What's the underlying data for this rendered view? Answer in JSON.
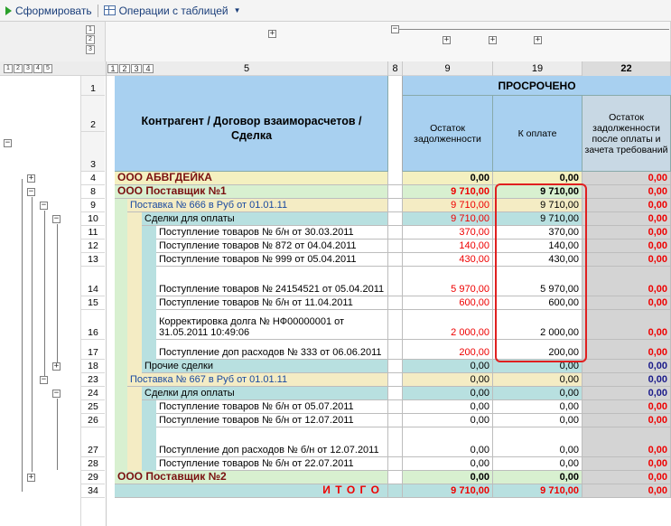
{
  "toolbar": {
    "generate_label": "Сформировать",
    "table_ops_label": "Операции с таблицей"
  },
  "column_numbers": {
    "c5": "5",
    "c8": "8",
    "c9": "9",
    "c19": "19",
    "c22": "22"
  },
  "level_buttons": [
    "1",
    "2",
    "3",
    "4",
    "5"
  ],
  "col_level_buttons": [
    "1",
    "2",
    "3"
  ],
  "header": {
    "overdue": "ПРОСРОЧЕНО",
    "main": "Контрагент / Договор взаиморасчетов / Сделка",
    "col9": "Остаток задолженности",
    "col19": "К оплате",
    "col22": "Остаток задолженности после оплаты и зачета требований"
  },
  "header_rows": [
    "1",
    "2",
    "3"
  ],
  "rows": [
    {
      "n": "4",
      "name": "ООО АБВГДЕЙКА",
      "c9": "0,00",
      "c19": "0,00",
      "c22": "0,00"
    },
    {
      "n": "8",
      "name": "ООО Поставщик №1",
      "c9": "9 710,00",
      "c19": "9 710,00",
      "c22": "0,00"
    },
    {
      "n": "9",
      "name": "Поставка № 666 в Руб от 01.01.11",
      "c9": "9 710,00",
      "c19": "9 710,00",
      "c22": "0,00"
    },
    {
      "n": "10",
      "name": "Сделки для оплаты",
      "c9": "9 710,00",
      "c19": "9 710,00",
      "c22": "0,00"
    },
    {
      "n": "11",
      "name": "Поступление товаров № б/н от 30.03.2011",
      "c9": "370,00",
      "c19": "370,00",
      "c22": "0,00"
    },
    {
      "n": "12",
      "name": "Поступление товаров № 872 от 04.04.2011",
      "c9": "140,00",
      "c19": "140,00",
      "c22": "0,00"
    },
    {
      "n": "13",
      "name": "Поступление товаров № 999 от 05.04.2011",
      "c9": "430,00",
      "c19": "430,00",
      "c22": "0,00"
    },
    {
      "n": "14",
      "name": "Поступление товаров № 24154521 от 05.04.2011",
      "c9": "5 970,00",
      "c19": "5 970,00",
      "c22": "0,00"
    },
    {
      "n": "15",
      "name": "Поступление товаров № б/н от 11.04.2011",
      "c9": "600,00",
      "c19": "600,00",
      "c22": "0,00"
    },
    {
      "n": "16",
      "name": "Корректировка долга № НФ00000001 от 31.05.2011 10:49:06",
      "c9": "2 000,00",
      "c19": "2 000,00",
      "c22": "0,00"
    },
    {
      "n": "17",
      "name": "Поступление доп расходов № 333 от 06.06.2011",
      "c9": "200,00",
      "c19": "200,00",
      "c22": "0,00"
    },
    {
      "n": "18",
      "name": "Прочие сделки",
      "c9": "0,00",
      "c19": "0,00",
      "c22": "0,00"
    },
    {
      "n": "23",
      "name": "Поставка № 667 в Руб от 01.01.11",
      "c9": "0,00",
      "c19": "0,00",
      "c22": "0,00"
    },
    {
      "n": "24",
      "name": "Сделки для оплаты",
      "c9": "0,00",
      "c19": "0,00",
      "c22": "0,00"
    },
    {
      "n": "25",
      "name": "Поступление товаров № б/н от 05.07.2011",
      "c9": "0,00",
      "c19": "0,00",
      "c22": "0,00"
    },
    {
      "n": "26",
      "name": "Поступление товаров № б/н от 12.07.2011",
      "c9": "0,00",
      "c19": "0,00",
      "c22": "0,00"
    },
    {
      "n": "27",
      "name": "Поступление доп расходов № б/н от 12.07.2011",
      "c9": "0,00",
      "c19": "0,00",
      "c22": "0,00"
    },
    {
      "n": "28",
      "name": "Поступление товаров № б/н от 22.07.2011",
      "c9": "0,00",
      "c19": "0,00",
      "c22": "0,00"
    },
    {
      "n": "29",
      "name": "ООО Поставщик №2",
      "c9": "0,00",
      "c19": "0,00",
      "c22": "0,00"
    },
    {
      "n": "34",
      "name": "И Т О Г О",
      "c9": "9 710,00",
      "c19": "9 710,00",
      "c22": "0,00"
    }
  ]
}
